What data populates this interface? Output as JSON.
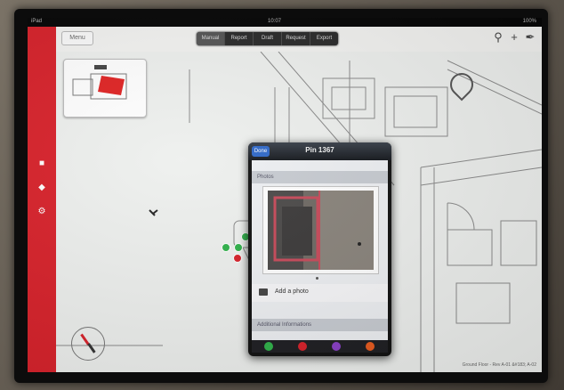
{
  "statusbar": {
    "left": "iPad",
    "center": "10:07",
    "right": "100%"
  },
  "toolbar": {
    "menu_label": "Menu",
    "segments": [
      "Manual",
      "Report",
      "Draft",
      "Request",
      "Export"
    ],
    "tool_icons": [
      "search-icon",
      "plus-icon",
      "edit-icon"
    ]
  },
  "sidebar": {
    "icons": [
      "list-icon",
      "bookmark-icon",
      "settings-icon"
    ]
  },
  "popover": {
    "done_label": "Done",
    "title": "Pin 1367",
    "photos_header": "Photos",
    "add_photo_label": "Add a photo",
    "info_header": "Additional Informations",
    "footer_colors": [
      "#2fb24a",
      "#d8212a",
      "#8a3fc8",
      "#e85a1e"
    ]
  },
  "pins": [
    {
      "color": "#2fb24a"
    },
    {
      "color": "#2fb24a"
    },
    {
      "color": "#d8212a"
    },
    {
      "color": "#2fb24a"
    }
  ],
  "colors": {
    "sidebar": "#d8212a",
    "accent_blue": "#2f68c8",
    "pin_green": "#2fb24a",
    "pin_red": "#d8212a"
  },
  "footnote": "Ground Floor - Rev A-01 &#183; A-02"
}
